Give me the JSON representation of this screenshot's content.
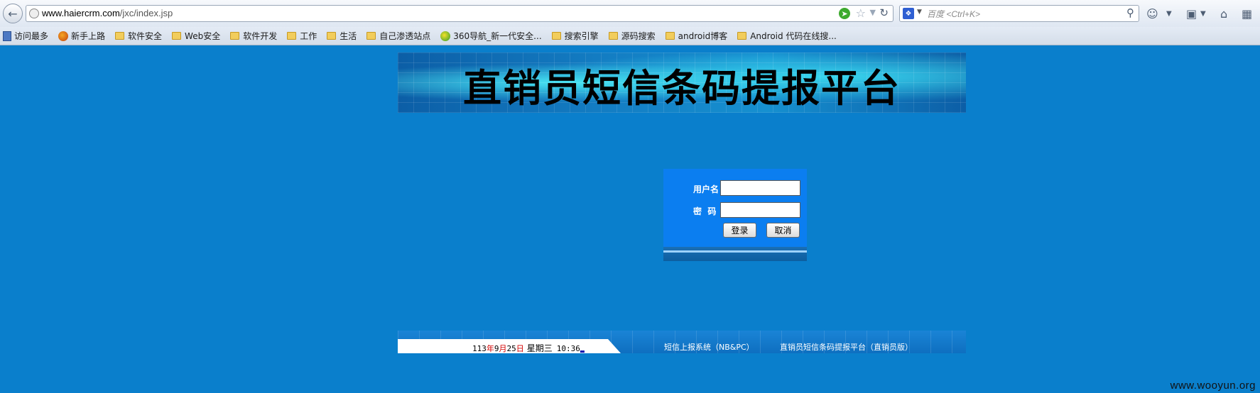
{
  "browser": {
    "url_host": "www.haiercrm.com",
    "url_path": "/jxc/index.jsp",
    "search_placeholder": "百度 <Ctrl+K>"
  },
  "bookmarks": [
    {
      "label": "访问最多",
      "icon": "bookmark-bar-icon"
    },
    {
      "label": "新手上路",
      "icon": "firefox-icon"
    },
    {
      "label": "软件安全",
      "icon": "folder-icon"
    },
    {
      "label": "Web安全",
      "icon": "folder-icon"
    },
    {
      "label": "软件开发",
      "icon": "folder-icon"
    },
    {
      "label": "工作",
      "icon": "folder-icon"
    },
    {
      "label": "生活",
      "icon": "folder-icon"
    },
    {
      "label": "自己渗透站点",
      "icon": "folder-icon"
    },
    {
      "label": "360导航_新一代安全...",
      "icon": "360-icon"
    },
    {
      "label": "搜索引擎",
      "icon": "folder-icon"
    },
    {
      "label": "源码搜索",
      "icon": "folder-icon"
    },
    {
      "label": "android博客",
      "icon": "folder-icon"
    },
    {
      "label": "Android 代码在线搜...",
      "icon": "folder-icon"
    }
  ],
  "page": {
    "banner_title": "直销员短信条码提报平台",
    "login": {
      "username_label": "用户名",
      "password_label": "密  码",
      "login_button": "登录",
      "cancel_button": "取消"
    },
    "footer": {
      "date_year": "113",
      "date_year_unit": "年",
      "date_month": "9",
      "date_month_unit": "月",
      "date_day": "25",
      "date_day_unit": "日",
      "weekday": "星期三",
      "time": "10:36",
      "link_sms": "短信上报系统（NB&PC）",
      "link_platform": "直销员短信条码提报平台（直销员版）"
    }
  },
  "watermark": "www.wooyun.org",
  "colors": {
    "page_background": "#0a7fcc",
    "login_box": "#0b7ef0"
  }
}
